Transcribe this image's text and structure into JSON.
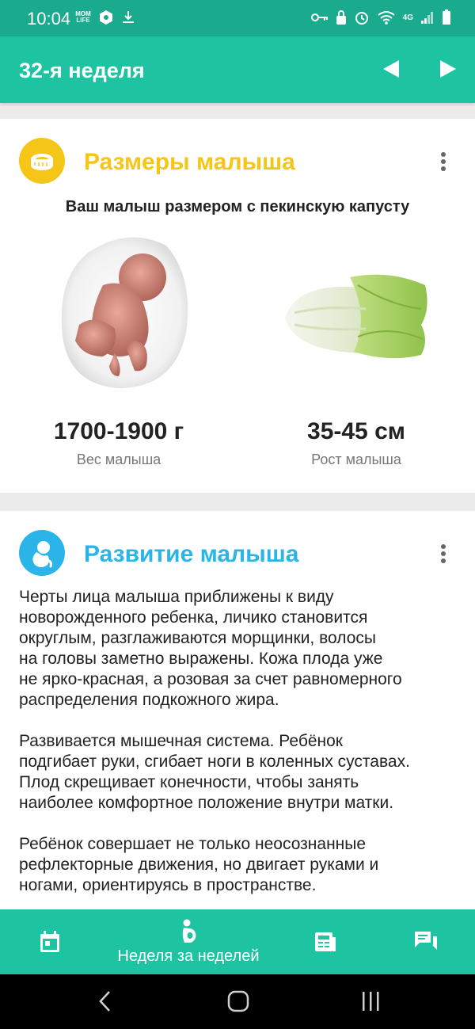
{
  "status_bar": {
    "time": "10:04",
    "app_badge": "MOM LIFE",
    "network_label": "4G"
  },
  "app_bar": {
    "title": "32-я неделя"
  },
  "size_card": {
    "title": "Размеры малыша",
    "title_color": "#f5c518",
    "subtitle": "Ваш малыш размером с пекинскую капусту",
    "weight_value": "1700-1900 г",
    "weight_label": "Вес малыша",
    "height_value": "35-45 см",
    "height_label": "Рост малыша"
  },
  "dev_card": {
    "title": "Развитие малыша",
    "title_color": "#2ab4e8",
    "paragraphs": [
      "Черты лица малыша приближены к виду\nноворожденного ребенка, личико становится\nокруглым, разглаживаются морщинки, волосы\nна головы заметно выражены. Кожа плода уже\nне ярко-красная, а розовая за счет равномерного\nраспределения подкожного жира.",
      "Развивается мышечная система. Ребёнок\nподгибает руки, сгибает ноги в коленных суставах.\nПлод скрещивает конечности, чтобы занять\nнаиболее комфортное положение внутри матки.",
      "Ребёнок совершает не только неосознанные\nрефлекторные движения, но двигает руками и\nногами, ориентируясь в пространстве."
    ]
  },
  "bottom_nav": {
    "active_label": "Неделя за неделей",
    "items": [
      "calendar-icon",
      "pregnancy-icon",
      "articles-icon",
      "chat-icon"
    ]
  },
  "colors": {
    "status_bar": "#1aab8e",
    "app_bar": "#1ec4a2",
    "accent_yellow": "#f5c518",
    "accent_blue": "#2ab4e8"
  }
}
